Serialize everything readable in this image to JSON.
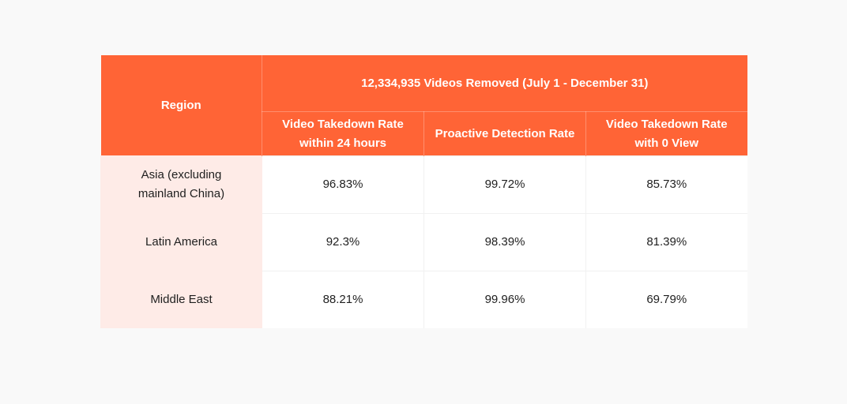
{
  "table": {
    "header": {
      "region_label": "Region",
      "group_label": "12,334,935 Videos Removed (July 1 - December 31)",
      "columns": [
        "Video Takedown Rate within 24 hours",
        "Proactive Detection Rate",
        "Video Takedown Rate with 0 View"
      ]
    },
    "rows": [
      {
        "region": "Asia (excluding mainland China)",
        "values": [
          "96.83%",
          "99.72%",
          "85.73%"
        ]
      },
      {
        "region": "Latin America",
        "values": [
          "92.3%",
          "98.39%",
          "81.39%"
        ]
      },
      {
        "region": "Middle East",
        "values": [
          "88.21%",
          "99.96%",
          "69.79%"
        ]
      }
    ]
  },
  "colors": {
    "header_bg": "#ff6436",
    "region_col_bg": "#feebe7",
    "page_bg": "#f9f9f9"
  }
}
